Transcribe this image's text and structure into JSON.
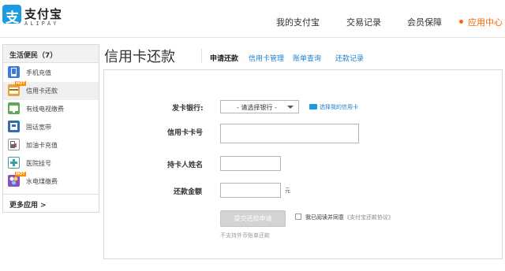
{
  "header": {
    "logo_text": "支付宝",
    "logo_sub": "ALIPAY",
    "logo_mark": "支",
    "nav": [
      {
        "label": "我的支付宝"
      },
      {
        "label": "交易记录"
      },
      {
        "label": "会员保障"
      },
      {
        "label": "应用中心",
        "active": true
      }
    ]
  },
  "sidebar": {
    "title": "生活便民（7）",
    "items": [
      {
        "label": "手机充值",
        "icon": "phone-icon",
        "color": "#3a7bd5"
      },
      {
        "label": "信用卡还款",
        "icon": "credit-card-icon",
        "color": "#e8a33d",
        "hot": true
      },
      {
        "label": "有线电视缴费",
        "icon": "tv-icon",
        "color": "#5fa85a"
      },
      {
        "label": "固话宽带",
        "icon": "landline-icon",
        "color": "#2f6fb0"
      },
      {
        "label": "加油卡充值",
        "icon": "fuel-icon",
        "color": "#d9534f"
      },
      {
        "label": "医院挂号",
        "icon": "hospital-icon",
        "color": "#3aa0a0"
      },
      {
        "label": "水电煤缴费",
        "icon": "utilities-icon",
        "color": "#8a4fbf",
        "hot": true
      }
    ],
    "hot_badge": "HOT",
    "more": "更多应用 >"
  },
  "main": {
    "title": "信用卡还款",
    "tabs": [
      {
        "label": "申请还款",
        "active": true
      },
      {
        "label": "信用卡管理"
      },
      {
        "label": "账单查询"
      },
      {
        "label": "还款记录"
      }
    ]
  },
  "form": {
    "bank_label": "发卡银行:",
    "bank_select": "- 请选择银行 -",
    "my_cards_link": "选择我的信用卡",
    "card_no_label": "信用卡卡号",
    "holder_label": "持卡人姓名",
    "amount_label": "还款金额",
    "amount_unit": "元",
    "submit_label": "提交还款申请",
    "agree_text": "我已阅读并同意",
    "agree_link": "《支付宝还款协议》",
    "note": "不支持外币账单还款"
  },
  "colors": {
    "accent": "#ff6600",
    "brand": "#1e9be0",
    "link": "#1e7fd0"
  }
}
